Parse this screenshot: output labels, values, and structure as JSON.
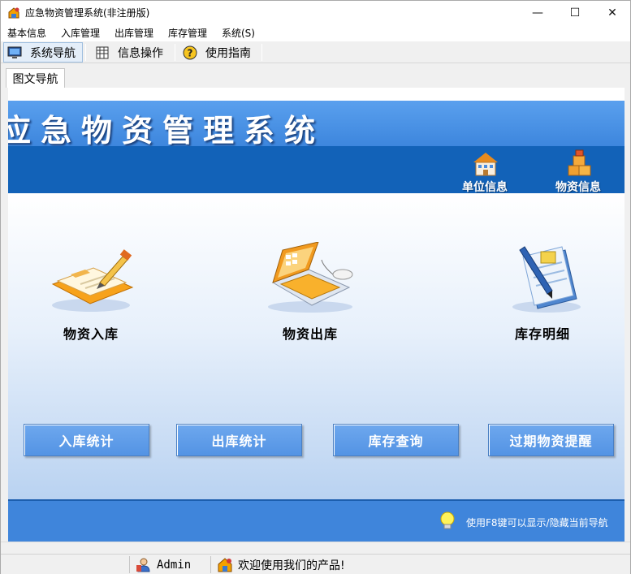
{
  "window": {
    "title": "应急物资管理系统(非注册版)",
    "controls": {
      "minimize": "—",
      "maximize": "☐",
      "close": "✕"
    }
  },
  "menubar": {
    "items": [
      {
        "label": "基本信息"
      },
      {
        "label": "入库管理"
      },
      {
        "label": "出库管理"
      },
      {
        "label": "库存管理"
      },
      {
        "label": "系统(S)"
      }
    ]
  },
  "toolbar": {
    "items": [
      {
        "label": "系统导航",
        "icon": "monitor-icon",
        "active": true
      },
      {
        "label": "信息操作",
        "icon": "grid-icon",
        "active": false
      },
      {
        "label": "使用指南",
        "icon": "help-icon",
        "active": false
      }
    ]
  },
  "tabs": [
    {
      "label": "图文导航"
    }
  ],
  "banner": {
    "title": "应急物资管理系统",
    "links": [
      {
        "label": "单位信息",
        "icon": "building-icon"
      },
      {
        "label": "物资信息",
        "icon": "boxes-icon"
      }
    ]
  },
  "main": {
    "items": [
      {
        "label": "物资入库",
        "icon": "notebook-pencil-icon"
      },
      {
        "label": "物资出库",
        "icon": "laptop-icon"
      },
      {
        "label": "库存明细",
        "icon": "document-pen-icon"
      }
    ],
    "buttons": [
      {
        "label": "入库统计"
      },
      {
        "label": "出库统计"
      },
      {
        "label": "库存查询"
      },
      {
        "label": "过期物资提醒"
      }
    ]
  },
  "footer": {
    "tip": "使用F8键可以显示/隐藏当前导航"
  },
  "statusbar": {
    "user": "Admin",
    "message": "欢迎使用我们的产品!"
  },
  "colors": {
    "banner": "#4a94e8",
    "subbanner": "#1262b8",
    "button": "#5d9ce8",
    "footer": "#3f85db"
  }
}
